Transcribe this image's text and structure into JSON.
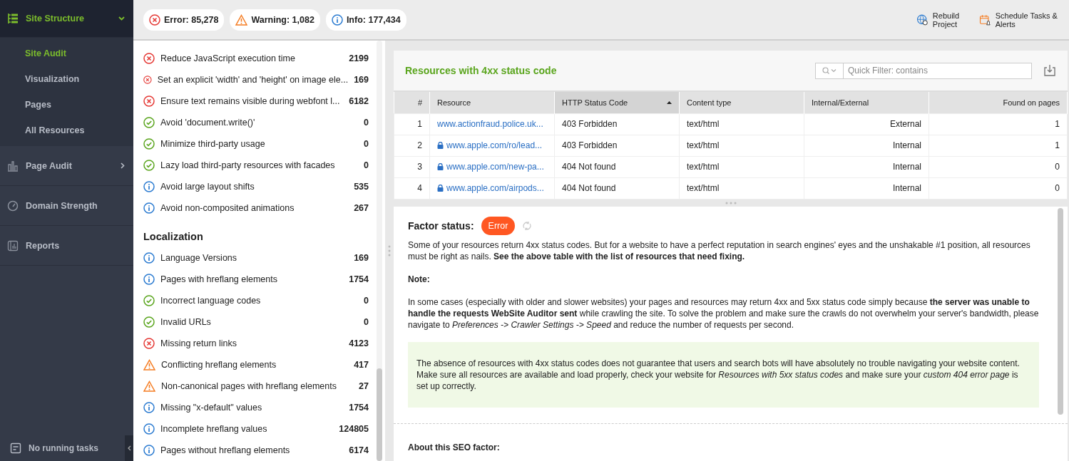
{
  "sidebar": {
    "sections": [
      {
        "label": "Site Structure",
        "expanded": true,
        "selected": true,
        "children": [
          {
            "label": "Site Audit",
            "selected": true
          },
          {
            "label": "Visualization",
            "selected": false
          },
          {
            "label": "Pages",
            "selected": false
          },
          {
            "label": "All Resources",
            "selected": false
          }
        ]
      },
      {
        "label": "Page Audit",
        "expanded": false,
        "selected": false
      },
      {
        "label": "Domain Strength",
        "selected": false
      },
      {
        "label": "Reports",
        "selected": false
      }
    ],
    "footer": "No running tasks"
  },
  "summary": [
    {
      "kind": "error",
      "label": "Error: 85,278"
    },
    {
      "kind": "warning",
      "label": "Warning: 1,082"
    },
    {
      "kind": "info",
      "label": "Info: 177,434"
    }
  ],
  "actions": [
    {
      "kind": "rebuild",
      "label": "Rebuild Project"
    },
    {
      "kind": "schedule",
      "label": "Schedule Tasks & Alerts"
    }
  ],
  "issue_groups": [
    {
      "items": [
        {
          "kind": "error",
          "label": "Reduce JavaScript execution time",
          "count": "2199"
        },
        {
          "kind": "error",
          "label": "Set an explicit 'width' and 'height' on image ele...",
          "count": "169"
        },
        {
          "kind": "error",
          "label": "Ensure text remains visible during webfont l...",
          "count": "6182"
        },
        {
          "kind": "ok",
          "label": "Avoid 'document.write()'",
          "count": "0"
        },
        {
          "kind": "ok",
          "label": "Minimize third-party usage",
          "count": "0"
        },
        {
          "kind": "ok",
          "label": "Lazy load third-party resources with facades",
          "count": "0"
        },
        {
          "kind": "info",
          "label": "Avoid large layout shifts",
          "count": "535"
        },
        {
          "kind": "info",
          "label": "Avoid non-composited animations",
          "count": "267"
        }
      ]
    },
    {
      "title": "Localization",
      "items": [
        {
          "kind": "info",
          "label": "Language Versions",
          "count": "169"
        },
        {
          "kind": "info",
          "label": "Pages with hreflang elements",
          "count": "1754"
        },
        {
          "kind": "ok",
          "label": "Incorrect language codes",
          "count": "0"
        },
        {
          "kind": "ok",
          "label": "Invalid URLs",
          "count": "0"
        },
        {
          "kind": "error",
          "label": "Missing return links",
          "count": "4123"
        },
        {
          "kind": "warning",
          "label": "Conflicting hreflang elements",
          "count": "417"
        },
        {
          "kind": "warning",
          "label": "Non-canonical pages with hreflang elements",
          "count": "27"
        },
        {
          "kind": "info",
          "label": "Missing \"x-default\" values",
          "count": "1754"
        },
        {
          "kind": "info",
          "label": "Incomplete hreflang values",
          "count": "124805"
        },
        {
          "kind": "info",
          "label": "Pages without hreflang elements",
          "count": "6174"
        }
      ]
    }
  ],
  "resources": {
    "title": "Resources with 4xx status code",
    "filter": {
      "placeholder": "Quick Filter: contains"
    },
    "columns": [
      {
        "label": "#",
        "selected": false
      },
      {
        "label": "Resource",
        "selected": false
      },
      {
        "label": "HTTP Status Code",
        "selected": true
      },
      {
        "label": "Content type",
        "selected": false
      },
      {
        "label": "Internal/External",
        "selected": false
      },
      {
        "label": "Found on pages",
        "selected": false
      }
    ],
    "rows": [
      {
        "index": "1",
        "resource": "www.actionfraud.police.uk...",
        "secure": false,
        "status": "403 Forbidden",
        "type": "text/html",
        "scope": "External",
        "found": "1"
      },
      {
        "index": "2",
        "resource": "www.apple.com/ro/lead...",
        "secure": true,
        "status": "403 Forbidden",
        "type": "text/html",
        "scope": "Internal",
        "found": "1"
      },
      {
        "index": "3",
        "resource": "www.apple.com/new-pa...",
        "secure": true,
        "status": "404 Not found",
        "type": "text/html",
        "scope": "Internal",
        "found": "0"
      },
      {
        "index": "4",
        "resource": "www.apple.com/airpods...",
        "secure": true,
        "status": "404 Not found",
        "type": "text/html",
        "scope": "Internal",
        "found": "0"
      }
    ]
  },
  "factor": {
    "label": "Factor status:",
    "status": "Error",
    "paragraphs": [
      "Some of your resources return 4xx status codes. But for a website to have a perfect reputation in search engines' eyes and the unshakable #1 position, all resources must be right as nails. **See the above table with the list of resources that need fixing.**",
      "**Note:**",
      "In some cases (especially with older and slower websites) your pages and resources may return 4xx and 5xx status code simply because **the server was unable to handle the requests WebSite Auditor sent** while crawling the site. To solve the problem and make sure the crawls do not overwhelm your server's bandwidth, please navigate to *Preferences -> Crawler Settings -> Speed* and reduce the number of requests per second."
    ],
    "tip": "The absence of resources with 4xx status codes does not guarantee that users and search bots will have absolutely no trouble navigating your website content. Make sure all resources are available and load properly, check your website for *Resources with 5xx status codes* and make sure your *custom 404 error page* is set up correctly.",
    "about": "About this SEO factor:"
  }
}
